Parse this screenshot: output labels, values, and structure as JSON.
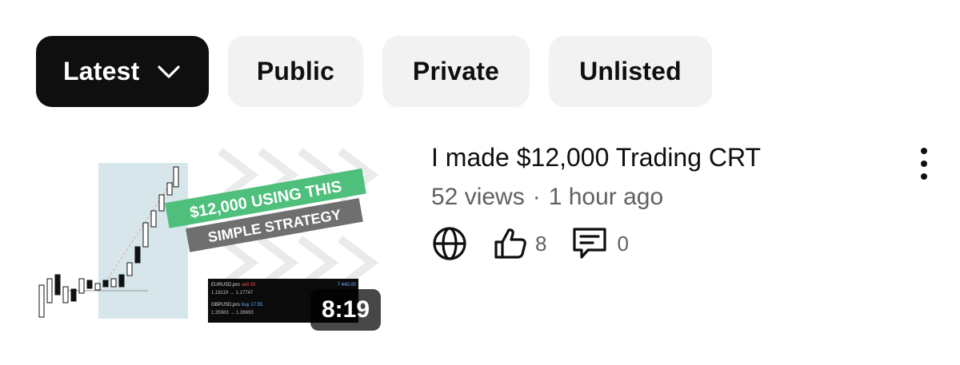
{
  "filters": {
    "chips": [
      {
        "label": "Latest",
        "active": true,
        "icon": "chevron-down-icon"
      },
      {
        "label": "Public",
        "active": false
      },
      {
        "label": "Private",
        "active": false
      },
      {
        "label": "Unlisted",
        "active": false
      }
    ]
  },
  "video": {
    "title": "I made $12,000 Trading CRT",
    "views": "52 views",
    "separator": "·",
    "age": "1 hour ago",
    "duration": "8:19",
    "likes": "8",
    "comments": "0",
    "visibility_icon": "globe-icon",
    "thumbnail": {
      "banner_line1": "$12,000 USING THIS",
      "banner_line2": "SIMPLE STRATEGY",
      "trade1_symbol": "EURUSD.pro",
      "trade1_side": "sell 20",
      "trade1_profit": "7 440.00",
      "trade1_prices": "1.18119 → 1.17747",
      "trade2_symbol": "GBPUSD.pro",
      "trade2_side": "buy 17.55",
      "trade2_prices": "1.35983 → 1.36693"
    }
  },
  "colors": {
    "active_chip_bg": "#0f0f0f",
    "chip_bg": "#f2f2f2",
    "banner_green": "#4fbf7c",
    "banner_gray": "#6f6f6f",
    "secondary_text": "#606060"
  }
}
